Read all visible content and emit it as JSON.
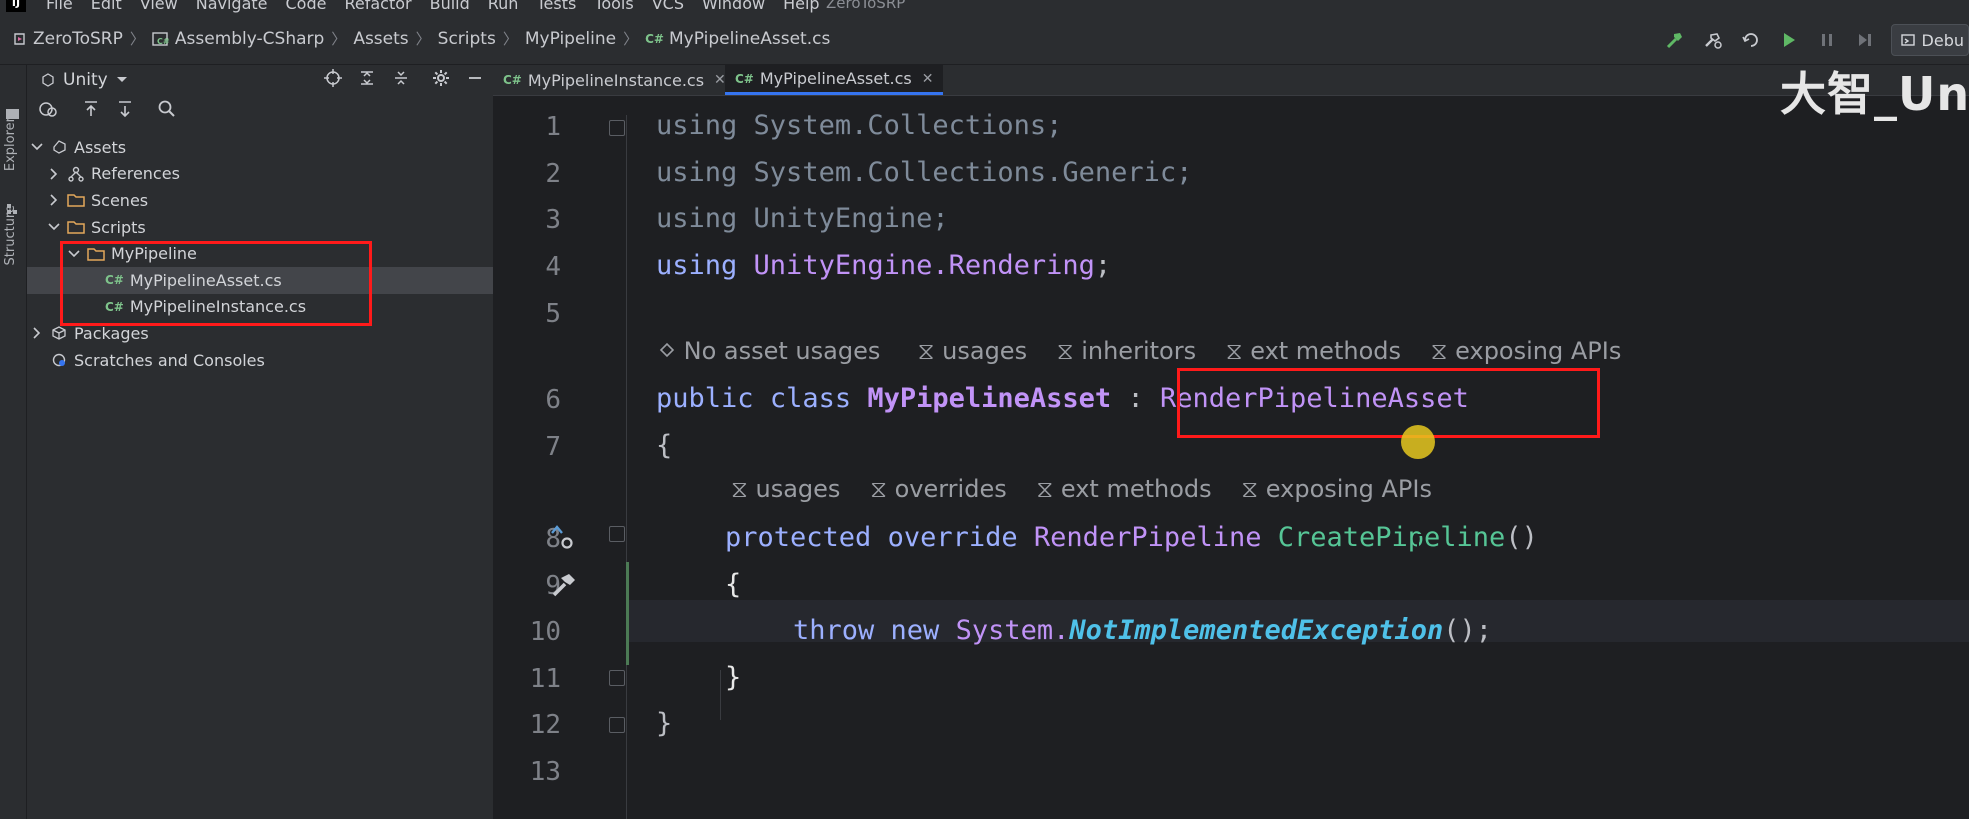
{
  "menu": {
    "logo": "IJ",
    "items": [
      "File",
      "Edit",
      "View",
      "Navigate",
      "Code",
      "Refactor",
      "Build",
      "Run",
      "Tests",
      "Tools",
      "VCS",
      "Window",
      "Help"
    ],
    "project_name": "ZeroToSRP"
  },
  "breadcrumb": {
    "items": [
      "ZeroToSRP",
      "Assembly-CSharp",
      "Assets",
      "Scripts",
      "MyPipeline",
      "MyPipelineAsset.cs"
    ]
  },
  "toolbar": {
    "debug_label": "Debu"
  },
  "side_tabs": {
    "explorer": "Explorer",
    "structure": "Structure"
  },
  "project_panel": {
    "title": "Unity",
    "tree": [
      {
        "label": "Assets",
        "level": 0,
        "expanded": true,
        "icon": "unity-folder-icon"
      },
      {
        "label": "References",
        "level": 1,
        "expanded": false,
        "icon": "references-icon"
      },
      {
        "label": "Scenes",
        "level": 1,
        "expanded": false,
        "icon": "folder-icon"
      },
      {
        "label": "Scripts",
        "level": 1,
        "expanded": true,
        "icon": "folder-icon"
      },
      {
        "label": "MyPipeline",
        "level": 2,
        "expanded": true,
        "icon": "folder-icon"
      },
      {
        "label": "MyPipelineAsset.cs",
        "level": 3,
        "icon": "csharp-file-icon",
        "selected": true
      },
      {
        "label": "MyPipelineInstance.cs",
        "level": 3,
        "icon": "csharp-file-icon"
      },
      {
        "label": "Packages",
        "level": 0,
        "expanded": false,
        "icon": "packages-icon"
      },
      {
        "label": "Scratches and Consoles",
        "level": 0,
        "icon": "scratches-icon"
      }
    ]
  },
  "editor": {
    "tabs": [
      {
        "label": "MyPipelineInstance.cs",
        "active": false
      },
      {
        "label": "MyPipelineAsset.cs",
        "active": true
      }
    ],
    "line_numbers": [
      "1",
      "2",
      "3",
      "4",
      "5",
      "6",
      "7",
      "8",
      "9",
      "10",
      "11",
      "12",
      "13"
    ],
    "code": {
      "l1": [
        "using",
        "System.Collections;"
      ],
      "l2": [
        "using",
        "System.Collections.Generic;"
      ],
      "l3": [
        "using",
        "UnityEngine;"
      ],
      "l4": [
        "using",
        "UnityEngine.Rendering",
        ";"
      ],
      "l6": [
        "public",
        "class",
        "MyPipelineAsset",
        ":",
        "RenderPipelineAsset"
      ],
      "l7": "{",
      "l8": [
        "protected",
        "override",
        "RenderPipeline",
        "CreatePipeline",
        "()"
      ],
      "l9": "{",
      "l10": [
        "throw",
        "new",
        "System.",
        "NotImplementedException",
        "();"
      ],
      "l11": "}",
      "l12": "}"
    },
    "class_hints": [
      "No asset usages",
      "usages",
      "inheritors",
      "ext methods",
      "exposing APIs"
    ],
    "method_hints": [
      "usages",
      "overrides",
      "ext methods",
      "exposing APIs"
    ]
  },
  "watermark": "大智_Un"
}
